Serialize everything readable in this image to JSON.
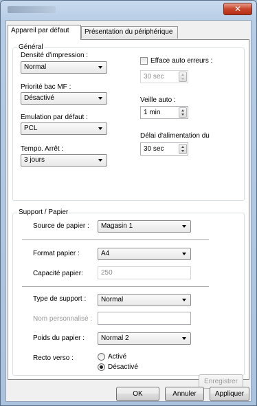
{
  "window": {
    "close_glyph": "✕"
  },
  "tabs": [
    {
      "label": "Appareil par défaut",
      "active": true
    },
    {
      "label": "Présentation du périphérique",
      "active": false
    }
  ],
  "general": {
    "legend": "Général",
    "density_label": "Densité d'impression :",
    "density_value": "Normal",
    "mf_tray_label": "Priorité bac MF :",
    "mf_tray_value": "Désactivé",
    "emulation_label": "Emulation par défaut :",
    "emulation_value": "PCL",
    "sleep_timer_label": "Tempo. Arrêt :",
    "sleep_timer_value": "3 jours",
    "auto_error_clear_label": "Efface auto erreurs :",
    "auto_error_clear_value": "30 sec",
    "auto_sleep_label": "Veille auto :",
    "auto_sleep_value": "1 min",
    "feed_delay_label": "Délai d'alimentation du",
    "feed_delay_value": "30 sec"
  },
  "support": {
    "legend": "Support / Papier",
    "source_label": "Source de papier :",
    "source_value": "Magasin 1",
    "format_label": "Format papier :",
    "format_value": "A4",
    "capacity_label": "Capacité papier:",
    "capacity_value": "250",
    "media_type_label": "Type de support :",
    "media_type_value": "Normal",
    "custom_name_label": "Nom personnalisé :",
    "custom_name_value": "",
    "weight_label": "Poids du papier :",
    "weight_value": "Normal 2",
    "duplex_label": "Recto verso :",
    "duplex_on_label": "Activé",
    "duplex_off_label": "Désactivé",
    "save_label": "Enregistrer"
  },
  "footer": {
    "ok_label": "OK",
    "cancel_label": "Annuler",
    "apply_label": "Appliquer"
  },
  "colors": {
    "titlebar": "#b7cde6",
    "close_button": "#c9452c",
    "panel_background": "#ffffff"
  }
}
